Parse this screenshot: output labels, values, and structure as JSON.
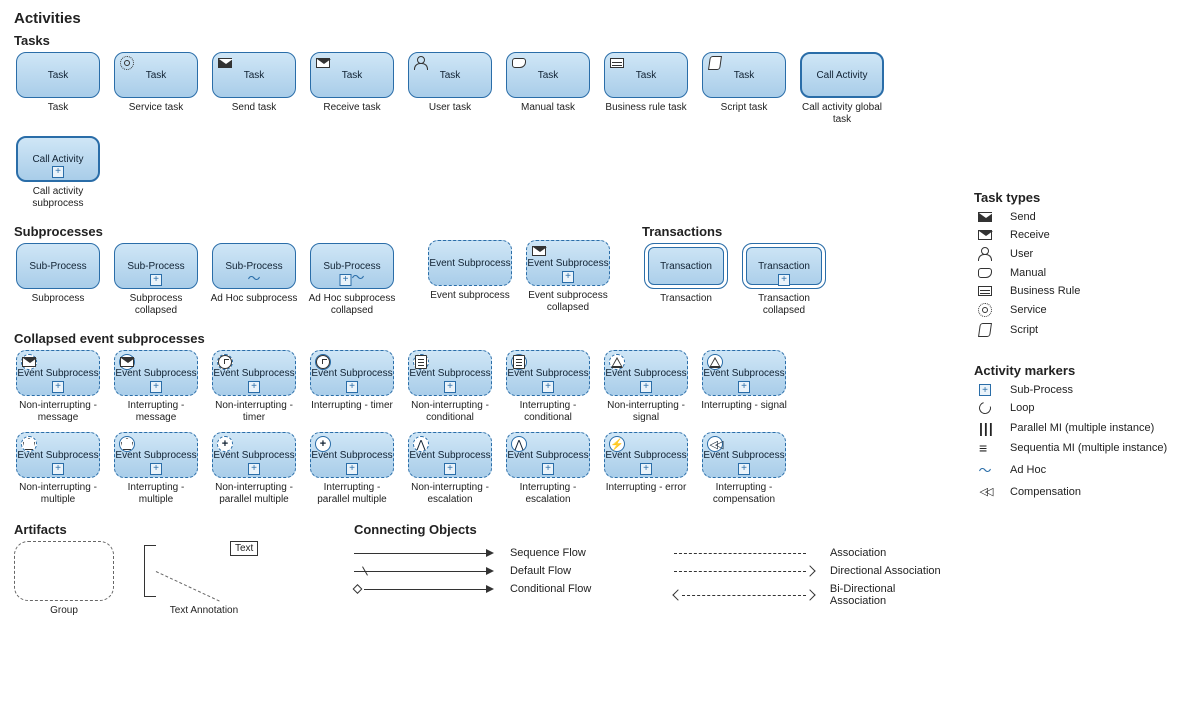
{
  "title": "Activities",
  "tasks_header": "Tasks",
  "tasks": [
    {
      "label": "Task",
      "caption": "Task",
      "icon": null
    },
    {
      "label": "Task",
      "caption": "Service task",
      "icon": "gear"
    },
    {
      "label": "Task",
      "caption": "Send task",
      "icon": "env-filled"
    },
    {
      "label": "Task",
      "caption": "Receive task",
      "icon": "env"
    },
    {
      "label": "Task",
      "caption": "User task",
      "icon": "user"
    },
    {
      "label": "Task",
      "caption": "Manual task",
      "icon": "hand"
    },
    {
      "label": "Task",
      "caption": "Business rule task",
      "icon": "rule"
    },
    {
      "label": "Task",
      "caption": "Script task",
      "icon": "script"
    },
    {
      "label": "Call Activity",
      "caption": "Call activity global task",
      "icon": null,
      "thick": true
    },
    {
      "label": "Call Activity",
      "caption": "Call activity subprocess",
      "icon": null,
      "thick": true,
      "marker": "plus"
    }
  ],
  "subprocesses_header": "Subprocesses",
  "subprocesses": [
    {
      "label": "Sub-Process",
      "caption": "Subprocess"
    },
    {
      "label": "Sub-Process",
      "caption": "Subprocess collapsed",
      "marker": "plus"
    },
    {
      "label": "Sub-Process",
      "caption": "Ad Hoc subprocess",
      "marker": "tilde"
    },
    {
      "label": "Sub-Process",
      "caption": "Ad Hoc subprocess collapsed",
      "marker": "plus-tilde"
    }
  ],
  "event_sub": [
    {
      "label": "Event Subprocess",
      "caption": "Event subprocess",
      "dashed": true
    },
    {
      "label": "Event Subprocess",
      "caption": "Event subprocess collapsed",
      "dashed": true,
      "marker": "plus",
      "icon": "env"
    }
  ],
  "transactions_header": "Transactions",
  "transactions": [
    {
      "label": "Transaction",
      "caption": "Transaction",
      "dbl": true
    },
    {
      "label": "Transaction",
      "caption": "Transaction collapsed",
      "dbl": true,
      "marker": "plus"
    }
  ],
  "collapsed_header": "Collapsed event subprocesses",
  "collapsed_rows": [
    [
      {
        "caption": "Non-interrupting - message",
        "icon": "env",
        "dashedCircle": true
      },
      {
        "caption": "Interrupting - message",
        "icon": "env",
        "dashedCircle": false
      },
      {
        "caption": "Non-interrupting - timer",
        "icon": "clock",
        "dashedCircle": true
      },
      {
        "caption": "Interrupting - timer",
        "icon": "clock",
        "dashedCircle": false
      },
      {
        "caption": "Non-interrupting - conditional",
        "icon": "doc",
        "dashedCircle": true
      },
      {
        "caption": "Interrupting - conditional",
        "icon": "doc",
        "dashedCircle": false
      },
      {
        "caption": "Non-interrupting - signal",
        "icon": "tri",
        "dashedCircle": true
      },
      {
        "caption": "Interrupting - signal",
        "icon": "tri",
        "dashedCircle": false
      }
    ],
    [
      {
        "caption": "Non-interrupting - multiple",
        "icon": "pent",
        "dashedCircle": true
      },
      {
        "caption": "Interrupting - multiple",
        "icon": "pent",
        "dashedCircle": false
      },
      {
        "caption": "Non-interrupting - parallel multiple",
        "icon": "plus",
        "dashedCircle": true
      },
      {
        "caption": "Interrupting - parallel multiple",
        "icon": "plus",
        "dashedCircle": false
      },
      {
        "caption": "Non-interrupting - escalation",
        "icon": "esc",
        "dashedCircle": true
      },
      {
        "caption": "Interrupting - escalation",
        "icon": "esc",
        "dashedCircle": false
      },
      {
        "caption": "Interrupting - error",
        "icon": "err",
        "dashedCircle": false
      },
      {
        "caption": "Interrupting - compensation",
        "icon": "rewind",
        "dashedCircle": false
      }
    ]
  ],
  "collapsed_label": "Event Subprocess",
  "artifacts_header": "Artifacts",
  "artifacts": {
    "group": "Group",
    "text_annot": "Text Annotation",
    "text_box": "Text"
  },
  "connecting_header": "Connecting Objects",
  "connecting_left": [
    {
      "name": "Sequence Flow",
      "kind": "seq"
    },
    {
      "name": "Default Flow",
      "kind": "default"
    },
    {
      "name": "Conditional Flow",
      "kind": "cond"
    }
  ],
  "connecting_right": [
    {
      "name": "Association",
      "kind": "assoc"
    },
    {
      "name": "Directional Association",
      "kind": "dir"
    },
    {
      "name": "Bi-Directional Association",
      "kind": "bidir"
    }
  ],
  "task_types_header": "Task types",
  "task_types": [
    {
      "label": "Send",
      "icon": "env-filled"
    },
    {
      "label": "Receive",
      "icon": "env"
    },
    {
      "label": "User",
      "icon": "user"
    },
    {
      "label": "Manual",
      "icon": "hand"
    },
    {
      "label": "Business Rule",
      "icon": "rule"
    },
    {
      "label": "Service",
      "icon": "gear"
    },
    {
      "label": "Script",
      "icon": "script"
    }
  ],
  "markers_header": "Activity markers",
  "markers": [
    {
      "label": "Sub-Process",
      "icon": "plusbox"
    },
    {
      "label": "Loop",
      "icon": "loop"
    },
    {
      "label": "Parallel MI (multiple instance)",
      "icon": "par"
    },
    {
      "label": "Sequentia MI (multiple instance)",
      "icon": "seq"
    },
    {
      "label": "Ad Hoc",
      "icon": "tilde"
    },
    {
      "label": "Compensation",
      "icon": "rewind"
    }
  ]
}
